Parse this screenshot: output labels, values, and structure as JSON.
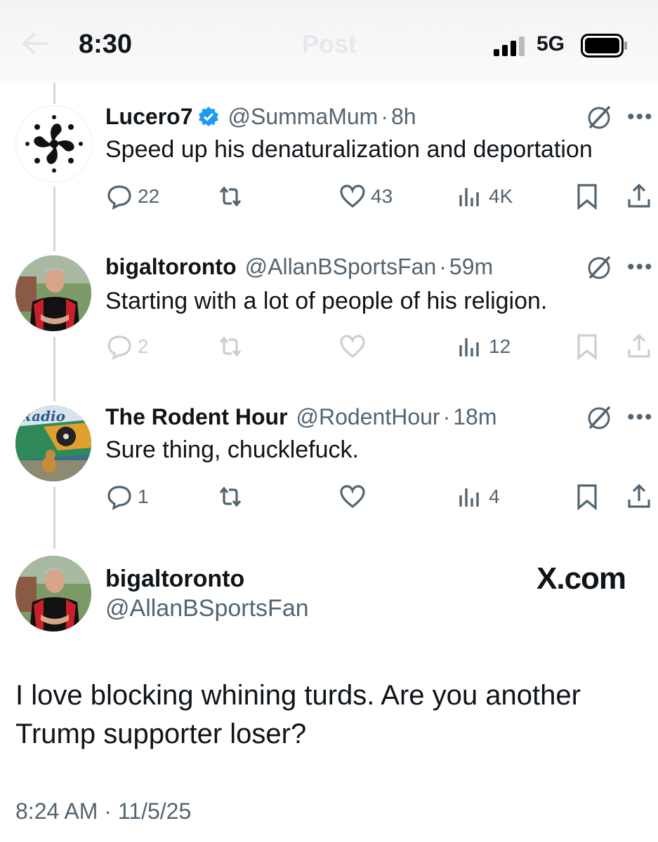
{
  "status_bar": {
    "time": "8:30",
    "network": "5G",
    "title": "Post"
  },
  "replies": [
    {
      "name": "Lucero7",
      "verified": true,
      "handle": "@SummaMum",
      "sep": "·",
      "ago": "8h",
      "text": "Speed up his denaturalization and deportation",
      "replies": "22",
      "reposts": "",
      "likes": "43",
      "views": "4K"
    },
    {
      "name": "bigaltoronto",
      "verified": false,
      "handle": "@AllanBSportsFan",
      "sep": "·",
      "ago": "59m",
      "text": "Starting with a lot of people of his religion.",
      "replies": "2",
      "reposts": "",
      "likes": "",
      "views": "12"
    },
    {
      "name": "The Rodent Hour",
      "verified": false,
      "handle": "@RodentHour",
      "sep": "·",
      "ago": "18m",
      "text": "Sure thing, chucklefuck.",
      "replies": "1",
      "reposts": "",
      "likes": "",
      "views": "4"
    }
  ],
  "main_post": {
    "name": "bigaltoronto",
    "handle": "@AllanBSportsFan",
    "watermark": "X.com",
    "text": "I love blocking whining turds. Are you another Trump supporter loser?",
    "timestamp": "8:24 AM · 11/5/25"
  },
  "colors": {
    "text": "#0f1419",
    "muted": "#536471",
    "verified": "#1d9bf0",
    "thread_line": "#cfd9de"
  },
  "icons": [
    "back-arrow-icon",
    "signal-icon",
    "battery-icon",
    "verified-badge-icon",
    "grok-icon",
    "more-icon",
    "reply-icon",
    "repost-icon",
    "like-icon",
    "views-icon",
    "bookmark-icon",
    "share-icon"
  ]
}
